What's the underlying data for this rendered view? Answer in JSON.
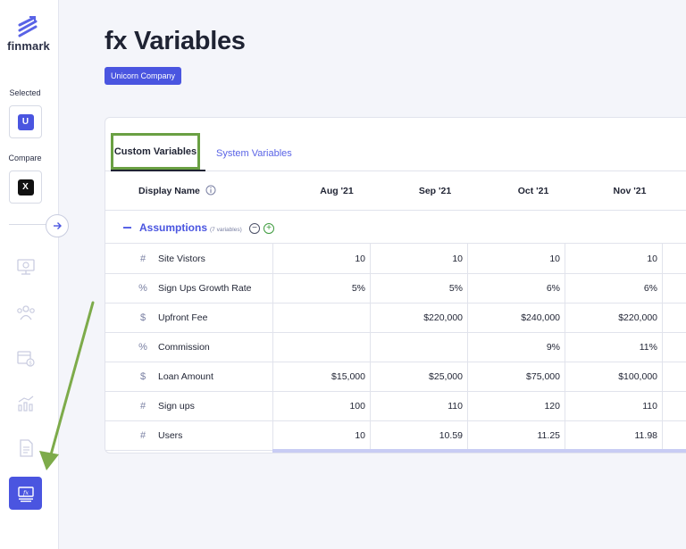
{
  "app": {
    "brand": "finmark"
  },
  "sidebar": {
    "selected_label": "Selected",
    "selected_badge": "U",
    "compare_label": "Compare",
    "compare_badge": "X",
    "nav_icons": [
      "dashboard-icon",
      "people-icon",
      "calendar-dollar-icon",
      "chart-icon",
      "document-icon",
      "fx-variables-icon"
    ]
  },
  "page": {
    "title": "fx Variables",
    "company": "Unicorn Company"
  },
  "tabs": {
    "custom": "Custom Variables",
    "system": "System Variables"
  },
  "table": {
    "name_header": "Display Name",
    "months": [
      "Aug '21",
      "Sep '21",
      "Oct '21",
      "Nov '21"
    ],
    "group": {
      "name": "Assumptions",
      "count": "(7 variables)"
    },
    "rows": [
      {
        "type": "#",
        "name": "Site Vistors",
        "values": [
          "10",
          "10",
          "10",
          "10"
        ]
      },
      {
        "type": "%",
        "name": "Sign Ups Growth Rate",
        "values": [
          "5%",
          "5%",
          "6%",
          "6%"
        ]
      },
      {
        "type": "$",
        "name": "Upfront Fee",
        "values": [
          "",
          "$220,000",
          "$240,000",
          "$220,000"
        ]
      },
      {
        "type": "%",
        "name": "Commission",
        "values": [
          "",
          "",
          "9%",
          "11%"
        ]
      },
      {
        "type": "$",
        "name": "Loan Amount",
        "values": [
          "$15,000",
          "$25,000",
          "$75,000",
          "$100,000"
        ]
      },
      {
        "type": "#",
        "name": "Sign ups",
        "values": [
          "100",
          "110",
          "120",
          "110"
        ]
      },
      {
        "type": "#",
        "name": "Users",
        "values": [
          "10",
          "10.59",
          "11.25",
          "11.98"
        ]
      }
    ]
  },
  "colors": {
    "accent": "#4a55e0",
    "highlight": "#6aa043",
    "compare_badge": "#111111"
  }
}
